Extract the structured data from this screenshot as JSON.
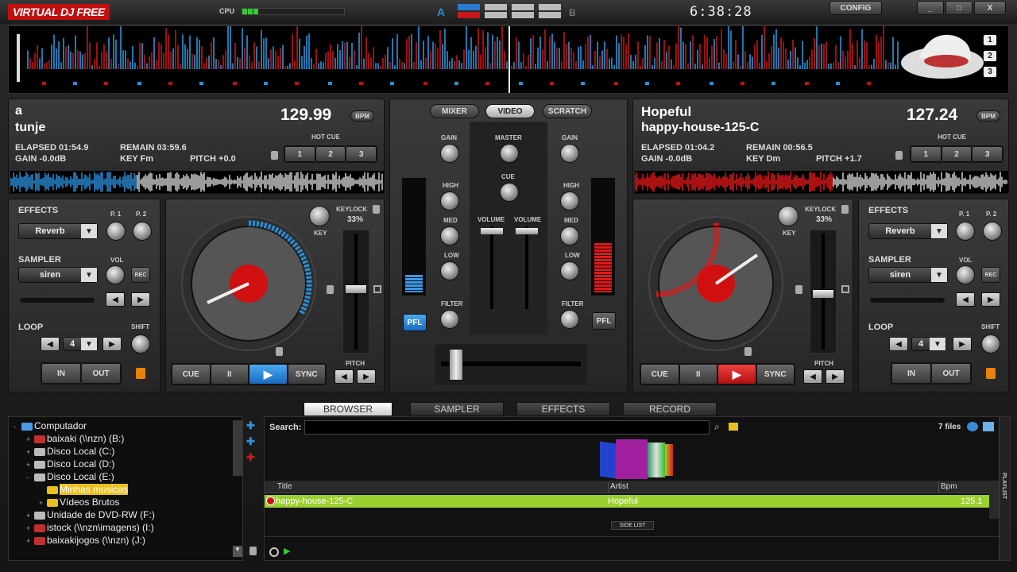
{
  "app": {
    "logo_a": "VIRTUAL",
    "logo_b": "DJ FREE",
    "cpu": "CPU",
    "clock": "6:38:28",
    "config": "CONFIG",
    "win_min": "_",
    "win_max": "□",
    "win_close": "X",
    "skin_a": "A",
    "skin_b": "B",
    "brand_color": "#c01010"
  },
  "overview": {
    "decks": [
      "1",
      "2",
      "3"
    ]
  },
  "deck1": {
    "title": "a",
    "track": "tunje",
    "bpm": "129.99",
    "bpm_tag": "BPM",
    "elapsed": "ELAPSED 01:54.9",
    "remain": "REMAIN 03:59.6",
    "gain": "GAIN -0.0dB",
    "key": "KEY Fm",
    "pitch": "PITCH +0.0",
    "hot_cue": "HOT CUE",
    "cues": [
      "1",
      "2",
      "3"
    ],
    "accent": "#2a8ed8",
    "effects_label": "EFFECTS",
    "effect": "Reverb",
    "p1": "P. 1",
    "p2": "P. 2",
    "sampler_label": "SAMPLER",
    "sample": "siren",
    "vol": "VOL",
    "rec": "REC",
    "loop_label": "LOOP",
    "loop_val": "4",
    "shift": "SHIFT",
    "in": "IN",
    "out": "OUT",
    "keylock": "KEYLOCK",
    "keylock_pct": "33%",
    "key_lbl": "KEY",
    "pitch_lbl": "PITCH",
    "cue_btn": "CUE",
    "pause_btn": "II",
    "play_btn": "▶",
    "sync_btn": "SYNC"
  },
  "deck2": {
    "title": "Hopeful",
    "track": "happy-house-125-C",
    "bpm": "127.24",
    "bpm_tag": "BPM",
    "elapsed": "ELAPSED 01:04.2",
    "remain": "REMAIN 00:56.5",
    "gain": "GAIN -0.0dB",
    "key": "KEY Dm",
    "pitch": "PITCH +1.7",
    "hot_cue": "HOT CUE",
    "cues": [
      "1",
      "2",
      "3"
    ],
    "accent": "#e01818",
    "effects_label": "EFFECTS",
    "effect": "Reverb",
    "p1": "P. 1",
    "p2": "P. 2",
    "sampler_label": "SAMPLER",
    "sample": "siren",
    "vol": "VOL",
    "rec": "REC",
    "loop_label": "LOOP",
    "loop_val": "4",
    "shift": "SHIFT",
    "in": "IN",
    "out": "OUT",
    "keylock": "KEYLOCK",
    "keylock_pct": "33%",
    "key_lbl": "KEY",
    "pitch_lbl": "PITCH",
    "cue_btn": "CUE",
    "pause_btn": "II",
    "play_btn": "▶",
    "sync_btn": "SYNC"
  },
  "mixer": {
    "tabs": [
      "MIXER",
      "VIDEO",
      "SCRATCH"
    ],
    "gain": "GAIN",
    "master": "MASTER",
    "cue": "CUE",
    "high": "HIGH",
    "med": "MED",
    "low": "LOW",
    "volume": "VOLUME",
    "filter": "FILTER",
    "pfl": "PFL"
  },
  "browser": {
    "tabs": [
      "BROWSER",
      "SAMPLER",
      "EFFECTS",
      "RECORD"
    ],
    "tree": [
      {
        "label": "Computador",
        "indent": 0,
        "exp": "-",
        "icon": "computer-icon"
      },
      {
        "label": "baixaki (\\\\nzn) (B:)",
        "indent": 1,
        "exp": "+",
        "icon": "network-drive-icon"
      },
      {
        "label": "Disco Local (C:)",
        "indent": 1,
        "exp": "+",
        "icon": "drive-icon"
      },
      {
        "label": "Disco Local (D:)",
        "indent": 1,
        "exp": "+",
        "icon": "drive-icon"
      },
      {
        "label": "Disco Local (E:)",
        "indent": 1,
        "exp": "-",
        "icon": "drive-icon"
      },
      {
        "label": "Minhas musicas",
        "indent": 2,
        "exp": "",
        "icon": "folder-icon",
        "selected": true
      },
      {
        "label": "Vídeos Brutos",
        "indent": 2,
        "exp": "+",
        "icon": "folder-icon"
      },
      {
        "label": "Unidade de DVD-RW (F:)",
        "indent": 1,
        "exp": "+",
        "icon": "dvd-icon"
      },
      {
        "label": "istock (\\\\nzn\\imagens) (I:)",
        "indent": 1,
        "exp": "+",
        "icon": "network-drive-icon"
      },
      {
        "label": "baixakijogos (\\\\nzn) (J:)",
        "indent": 1,
        "exp": "+",
        "icon": "network-drive-icon"
      }
    ],
    "search_label": "Search:",
    "search_value": "",
    "files": "7 files",
    "columns": [
      "Title",
      "Artist",
      "Bpm"
    ],
    "rows": [
      {
        "title": "happy-house-125-C",
        "artist": "Hopeful",
        "bpm": "125.1"
      }
    ],
    "side_list": "SIDE LIST",
    "playlist": "PLAYLIST"
  }
}
